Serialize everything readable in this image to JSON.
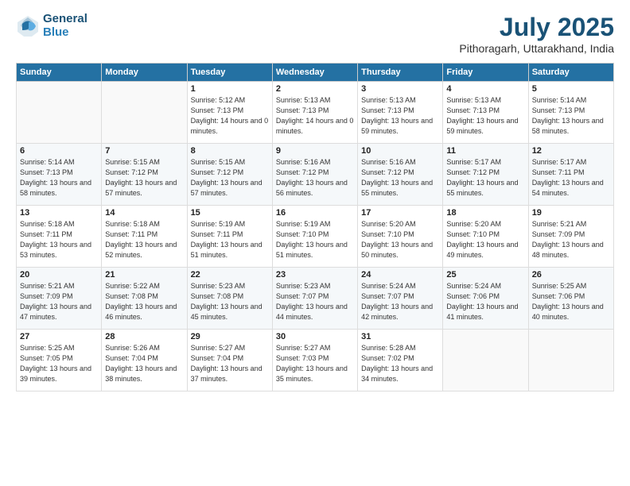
{
  "header": {
    "logo_line1": "General",
    "logo_line2": "Blue",
    "month_title": "July 2025",
    "subtitle": "Pithoragarh, Uttarakhand, India"
  },
  "weekdays": [
    "Sunday",
    "Monday",
    "Tuesday",
    "Wednesday",
    "Thursday",
    "Friday",
    "Saturday"
  ],
  "weeks": [
    [
      {
        "day": "",
        "sunrise": "",
        "sunset": "",
        "daylight": ""
      },
      {
        "day": "",
        "sunrise": "",
        "sunset": "",
        "daylight": ""
      },
      {
        "day": "1",
        "sunrise": "Sunrise: 5:12 AM",
        "sunset": "Sunset: 7:13 PM",
        "daylight": "Daylight: 14 hours and 0 minutes."
      },
      {
        "day": "2",
        "sunrise": "Sunrise: 5:13 AM",
        "sunset": "Sunset: 7:13 PM",
        "daylight": "Daylight: 14 hours and 0 minutes."
      },
      {
        "day": "3",
        "sunrise": "Sunrise: 5:13 AM",
        "sunset": "Sunset: 7:13 PM",
        "daylight": "Daylight: 13 hours and 59 minutes."
      },
      {
        "day": "4",
        "sunrise": "Sunrise: 5:13 AM",
        "sunset": "Sunset: 7:13 PM",
        "daylight": "Daylight: 13 hours and 59 minutes."
      },
      {
        "day": "5",
        "sunrise": "Sunrise: 5:14 AM",
        "sunset": "Sunset: 7:13 PM",
        "daylight": "Daylight: 13 hours and 58 minutes."
      }
    ],
    [
      {
        "day": "6",
        "sunrise": "Sunrise: 5:14 AM",
        "sunset": "Sunset: 7:13 PM",
        "daylight": "Daylight: 13 hours and 58 minutes."
      },
      {
        "day": "7",
        "sunrise": "Sunrise: 5:15 AM",
        "sunset": "Sunset: 7:12 PM",
        "daylight": "Daylight: 13 hours and 57 minutes."
      },
      {
        "day": "8",
        "sunrise": "Sunrise: 5:15 AM",
        "sunset": "Sunset: 7:12 PM",
        "daylight": "Daylight: 13 hours and 57 minutes."
      },
      {
        "day": "9",
        "sunrise": "Sunrise: 5:16 AM",
        "sunset": "Sunset: 7:12 PM",
        "daylight": "Daylight: 13 hours and 56 minutes."
      },
      {
        "day": "10",
        "sunrise": "Sunrise: 5:16 AM",
        "sunset": "Sunset: 7:12 PM",
        "daylight": "Daylight: 13 hours and 55 minutes."
      },
      {
        "day": "11",
        "sunrise": "Sunrise: 5:17 AM",
        "sunset": "Sunset: 7:12 PM",
        "daylight": "Daylight: 13 hours and 55 minutes."
      },
      {
        "day": "12",
        "sunrise": "Sunrise: 5:17 AM",
        "sunset": "Sunset: 7:11 PM",
        "daylight": "Daylight: 13 hours and 54 minutes."
      }
    ],
    [
      {
        "day": "13",
        "sunrise": "Sunrise: 5:18 AM",
        "sunset": "Sunset: 7:11 PM",
        "daylight": "Daylight: 13 hours and 53 minutes."
      },
      {
        "day": "14",
        "sunrise": "Sunrise: 5:18 AM",
        "sunset": "Sunset: 7:11 PM",
        "daylight": "Daylight: 13 hours and 52 minutes."
      },
      {
        "day": "15",
        "sunrise": "Sunrise: 5:19 AM",
        "sunset": "Sunset: 7:11 PM",
        "daylight": "Daylight: 13 hours and 51 minutes."
      },
      {
        "day": "16",
        "sunrise": "Sunrise: 5:19 AM",
        "sunset": "Sunset: 7:10 PM",
        "daylight": "Daylight: 13 hours and 51 minutes."
      },
      {
        "day": "17",
        "sunrise": "Sunrise: 5:20 AM",
        "sunset": "Sunset: 7:10 PM",
        "daylight": "Daylight: 13 hours and 50 minutes."
      },
      {
        "day": "18",
        "sunrise": "Sunrise: 5:20 AM",
        "sunset": "Sunset: 7:10 PM",
        "daylight": "Daylight: 13 hours and 49 minutes."
      },
      {
        "day": "19",
        "sunrise": "Sunrise: 5:21 AM",
        "sunset": "Sunset: 7:09 PM",
        "daylight": "Daylight: 13 hours and 48 minutes."
      }
    ],
    [
      {
        "day": "20",
        "sunrise": "Sunrise: 5:21 AM",
        "sunset": "Sunset: 7:09 PM",
        "daylight": "Daylight: 13 hours and 47 minutes."
      },
      {
        "day": "21",
        "sunrise": "Sunrise: 5:22 AM",
        "sunset": "Sunset: 7:08 PM",
        "daylight": "Daylight: 13 hours and 46 minutes."
      },
      {
        "day": "22",
        "sunrise": "Sunrise: 5:23 AM",
        "sunset": "Sunset: 7:08 PM",
        "daylight": "Daylight: 13 hours and 45 minutes."
      },
      {
        "day": "23",
        "sunrise": "Sunrise: 5:23 AM",
        "sunset": "Sunset: 7:07 PM",
        "daylight": "Daylight: 13 hours and 44 minutes."
      },
      {
        "day": "24",
        "sunrise": "Sunrise: 5:24 AM",
        "sunset": "Sunset: 7:07 PM",
        "daylight": "Daylight: 13 hours and 42 minutes."
      },
      {
        "day": "25",
        "sunrise": "Sunrise: 5:24 AM",
        "sunset": "Sunset: 7:06 PM",
        "daylight": "Daylight: 13 hours and 41 minutes."
      },
      {
        "day": "26",
        "sunrise": "Sunrise: 5:25 AM",
        "sunset": "Sunset: 7:06 PM",
        "daylight": "Daylight: 13 hours and 40 minutes."
      }
    ],
    [
      {
        "day": "27",
        "sunrise": "Sunrise: 5:25 AM",
        "sunset": "Sunset: 7:05 PM",
        "daylight": "Daylight: 13 hours and 39 minutes."
      },
      {
        "day": "28",
        "sunrise": "Sunrise: 5:26 AM",
        "sunset": "Sunset: 7:04 PM",
        "daylight": "Daylight: 13 hours and 38 minutes."
      },
      {
        "day": "29",
        "sunrise": "Sunrise: 5:27 AM",
        "sunset": "Sunset: 7:04 PM",
        "daylight": "Daylight: 13 hours and 37 minutes."
      },
      {
        "day": "30",
        "sunrise": "Sunrise: 5:27 AM",
        "sunset": "Sunset: 7:03 PM",
        "daylight": "Daylight: 13 hours and 35 minutes."
      },
      {
        "day": "31",
        "sunrise": "Sunrise: 5:28 AM",
        "sunset": "Sunset: 7:02 PM",
        "daylight": "Daylight: 13 hours and 34 minutes."
      },
      {
        "day": "",
        "sunrise": "",
        "sunset": "",
        "daylight": ""
      },
      {
        "day": "",
        "sunrise": "",
        "sunset": "",
        "daylight": ""
      }
    ]
  ]
}
